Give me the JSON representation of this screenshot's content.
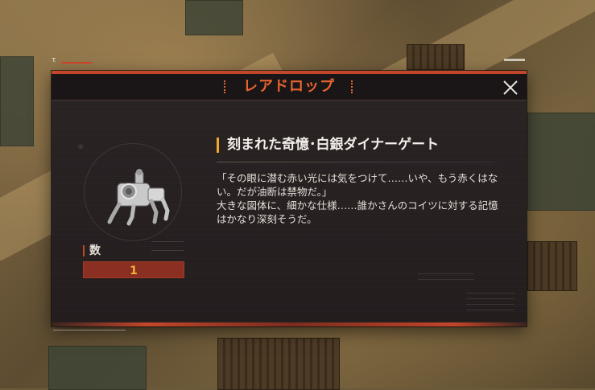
{
  "dialog": {
    "title": "レアドロップ",
    "close_icon": "close-icon",
    "accent_color": "#e7642f"
  },
  "item": {
    "icon": "mech-robot-icon",
    "name": "刻まれた奇憶･白銀ダイナーゲート",
    "description": [
      "「その眼に潜む赤い光には気をつけて……いや、もう赤くはない。だが油断は禁物だ。」",
      "大きな図体に、細かな仕様……誰かさんのコイツに対する記憶はかなり深刻そうだ。"
    ]
  },
  "quantity": {
    "label": "数",
    "value": "1"
  }
}
